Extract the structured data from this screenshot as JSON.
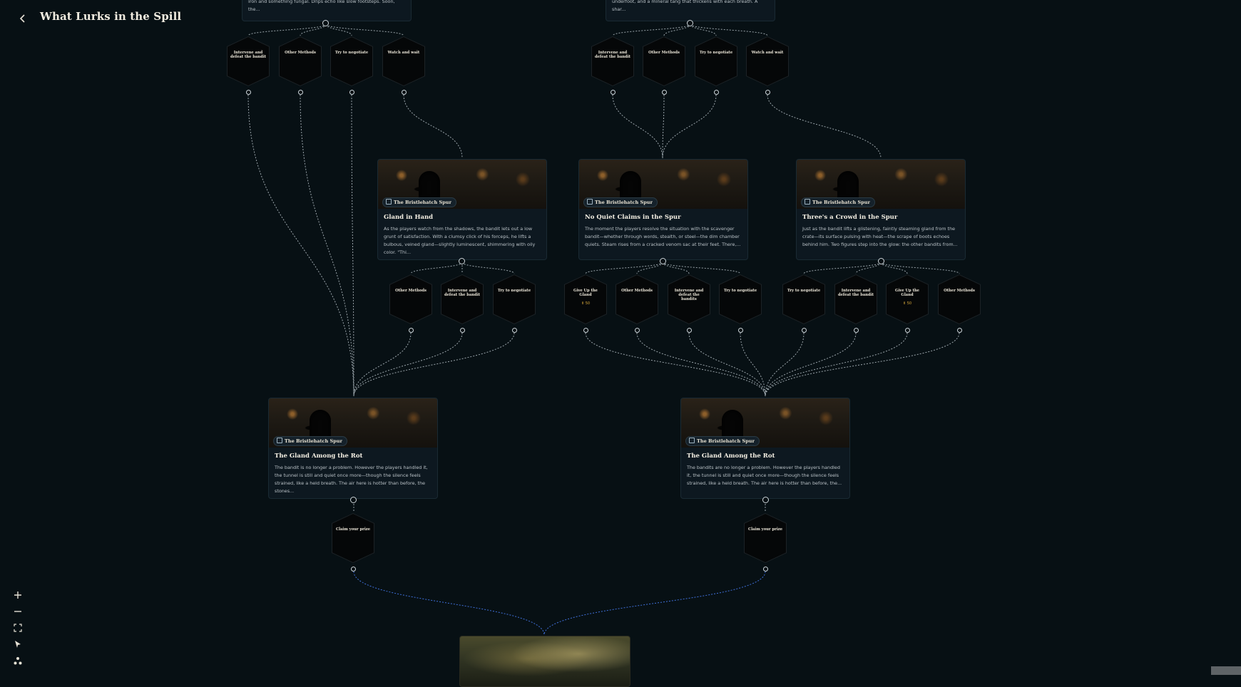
{
  "header": {
    "title": "What Lurks in the Spill"
  },
  "location_badge": "The Bristlehatch Spur",
  "top_cards": [
    {
      "desc": "iron and something fungal. Drips echo like slow footsteps. Soon, the..."
    },
    {
      "desc": "underfoot, and a mineral tang that thickens with each breath. A shar..."
    }
  ],
  "choices": {
    "top_left": [
      "Intervene and defeat the bandit",
      "Other Methods",
      "Try to negotiate",
      "Watch and wait"
    ],
    "top_right": [
      "Intervene and defeat the bandit",
      "Other Methods",
      "Try to negotiate",
      "Watch and wait"
    ],
    "gland": [
      "Other Methods",
      "Intervene and defeat the bandit",
      "Try to negotiate"
    ],
    "quiet": [
      "Give Up the Gland",
      "Other Methods",
      "Intervene and defeat the bandits",
      "Try to negotiate"
    ],
    "crowd": [
      "Try to negotiate",
      "Intervene and defeat the bandit",
      "Give Up the Gland",
      "Other Methods"
    ],
    "claim_left": [
      "Claim your prize"
    ],
    "claim_right": [
      "Claim your prize"
    ]
  },
  "gold_tags": {
    "quiet_0": "⚱ 50",
    "crowd_2": "⚱ 50"
  },
  "scenes": [
    {
      "title": "Gland in Hand",
      "desc": "As the players watch from the shadows, the bandit lets out a low grunt of satisfaction. With a clumsy click of his forceps, he lifts a bulbous, veined gland—slightly luminescent, shimmering with oily color. \"Thi..."
    },
    {
      "title": "No Quiet Claims in the Spur",
      "desc": "The moment the players resolve the situation with the scavenger bandit—whether through words, stealth, or steel—the dim chamber quiets. Steam rises from a cracked venom sac at their feet. There,..."
    },
    {
      "title": "Three's a Crowd in the Spur",
      "desc": "Just as the bandit lifts a glistening, faintly steaming gland from the crate—its surface pulsing with heat—the scrape of boots echoes behind him. Two figures step into the glow: the other bandits from..."
    },
    {
      "title": "The Gland Among the Rot",
      "desc": "The bandit is no longer a problem. However the players handled it, the tunnel is still and quiet once more—though the silence feels strained, like a held breath. The air here is hotter than before, the stones..."
    },
    {
      "title": "The Gland Among the Rot",
      "desc": "The bandits are no longer a problem. However the players handled it, the tunnel is still and quiet once more—though the silence feels strained, like a held breath. The air here is hotter than before, the..."
    }
  ],
  "controls": {
    "zoom_in": "+",
    "zoom_out": "−"
  },
  "colors": {
    "background": "#071014",
    "edge": "#9aa4aa",
    "edge_final": "#3f6fd8",
    "gold": "#d8a93a"
  }
}
